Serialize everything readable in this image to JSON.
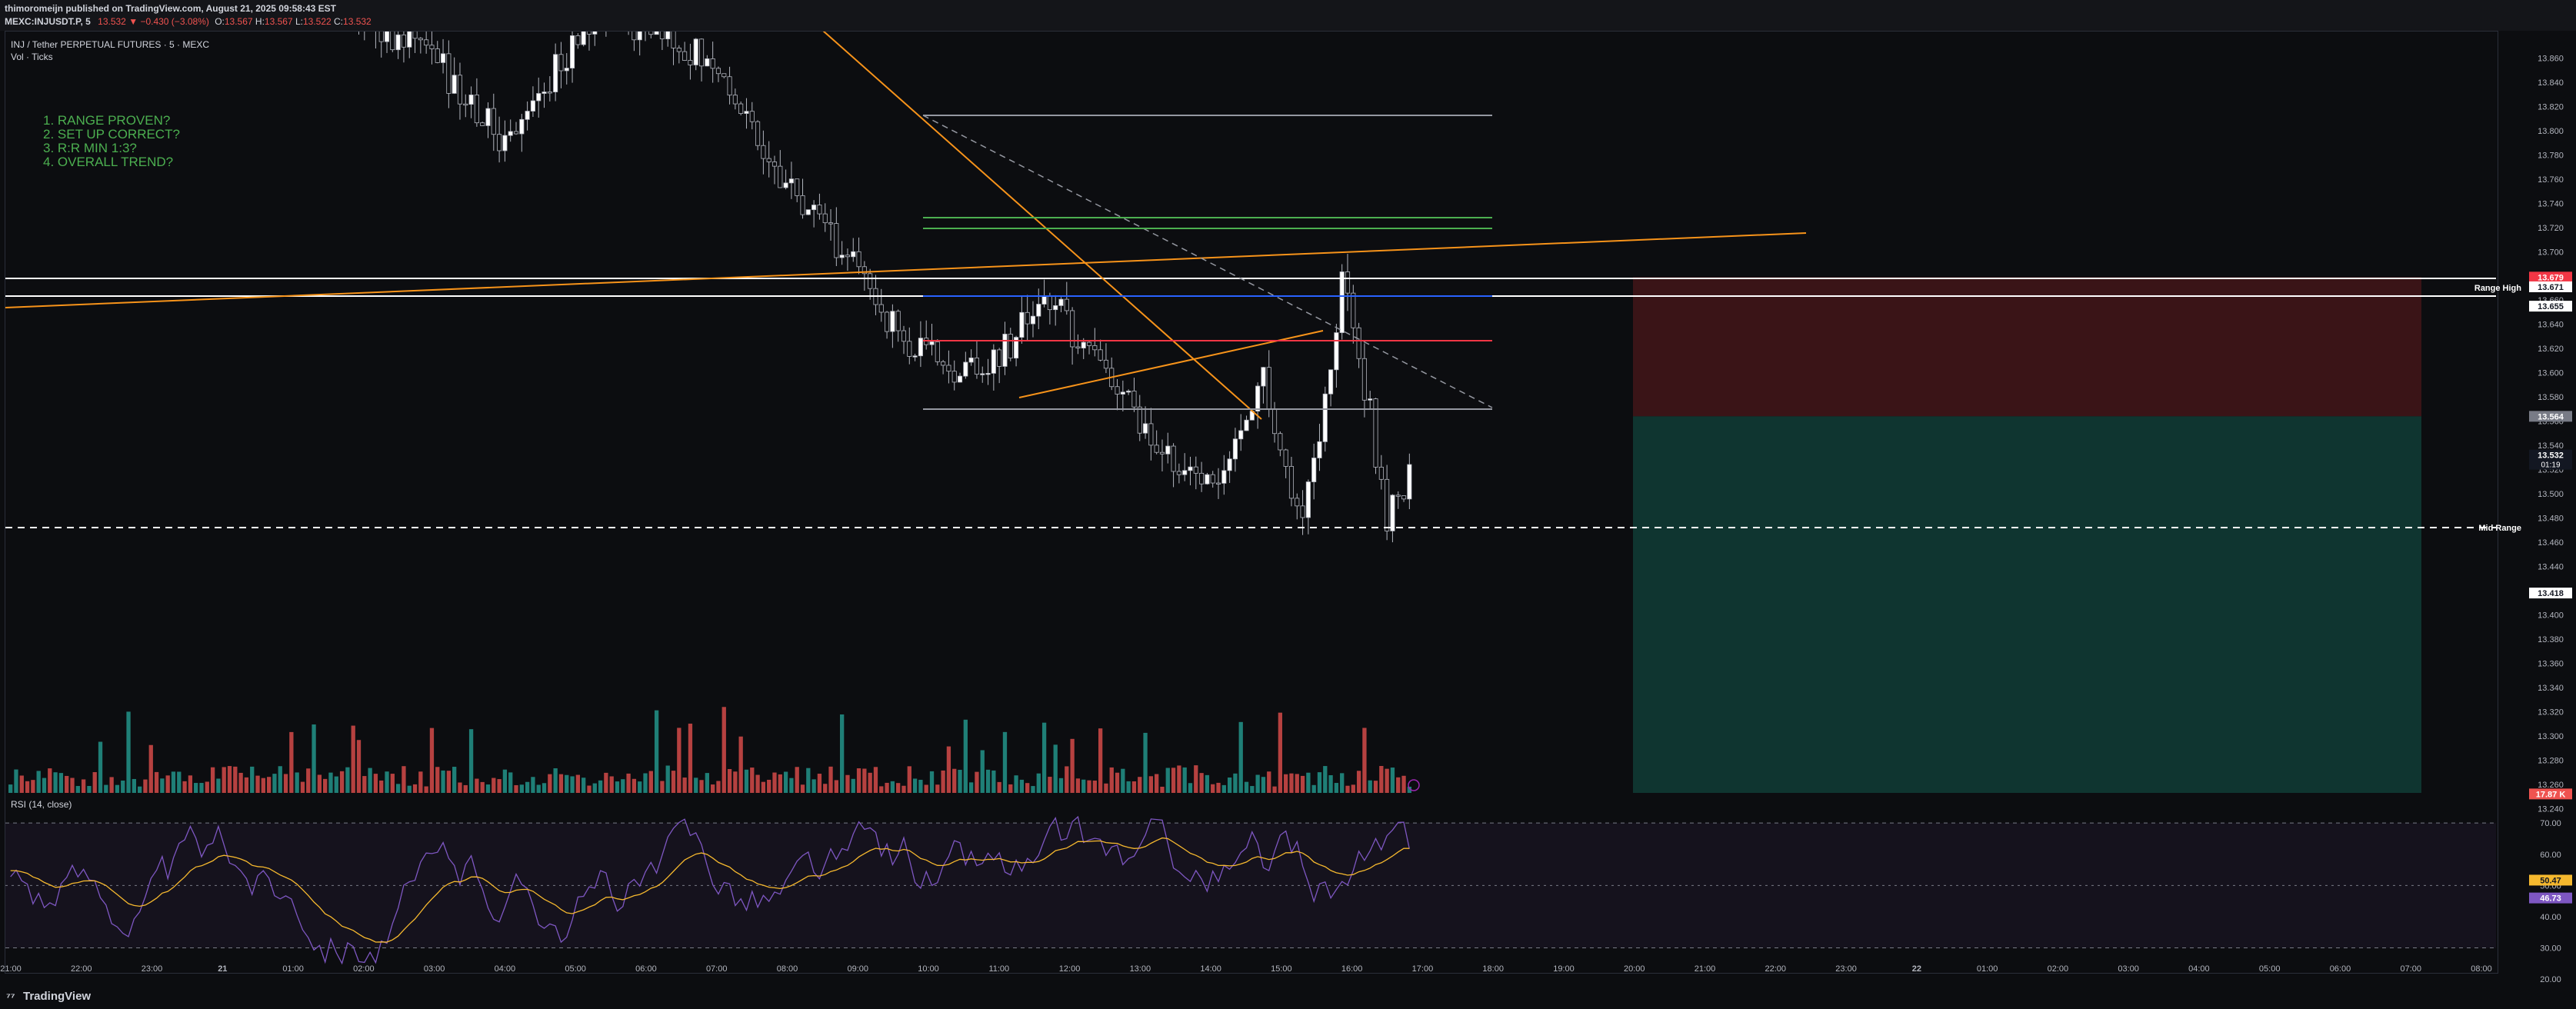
{
  "header": {
    "publisher_line": "thimoromeijn published on TradingView.com, August 21, 2025 09:58:43 EST",
    "symbol": "MEXC:INJUSDT.P, 5",
    "last": "13.532",
    "change_arrow": "▼",
    "change": "−0.430 (−3.08%)",
    "open": "13.567",
    "high": "13.567",
    "low": "13.522",
    "close": "13.532",
    "ohlc_labels": [
      "O:",
      "H:",
      "L:",
      "C:"
    ]
  },
  "legend": {
    "title": "INJ / Tether PERPETUAL FUTURES · 5 · MEXC",
    "subtitle": "Vol · Ticks"
  },
  "checklist": [
    "1. RANGE PROVEN?",
    "2. SET UP CORRECT?",
    "3. R:R MIN 1:3?",
    "4. OVERALL TREND?"
  ],
  "rsi_label": "RSI (14, close)",
  "footer_brand": "TradingView",
  "colors": {
    "bg": "#0c0d10",
    "up": "#26a69a",
    "down": "#ef5350",
    "candle_up": "#ffffff",
    "orange": "#f7931a",
    "green_line": "#4caf50",
    "red_line": "#f23645",
    "blue_line": "#2962ff",
    "rsi_line": "#7e57c2",
    "rsi_ma": "#f5b82e",
    "tp_zone": "#0f3530",
    "sl_zone": "#3a1417"
  },
  "chart_data": {
    "type": "candlestick",
    "title": "INJ / Tether PERPETUAL FUTURES · 5 · MEXC",
    "price_axis": {
      "ylim": [
        13.23,
        13.88
      ],
      "ticks": [
        "13.860",
        "13.840",
        "13.820",
        "13.800",
        "13.780",
        "13.760",
        "13.740",
        "13.720",
        "13.700",
        "13.680",
        "13.660",
        "13.640",
        "13.620",
        "13.600",
        "13.580",
        "13.560",
        "13.540",
        "13.520",
        "13.500",
        "13.480",
        "13.460",
        "13.440",
        "13.420",
        "13.400",
        "13.380",
        "13.360",
        "13.340",
        "13.320",
        "13.300",
        "13.280",
        "13.260",
        "13.240"
      ]
    },
    "time_axis": {
      "labels": [
        "21:00",
        "22:00",
        "23:00",
        "21",
        "01:00",
        "02:00",
        "03:00",
        "04:00",
        "05:00",
        "06:00",
        "07:00",
        "08:00",
        "09:00",
        "10:00",
        "11:00",
        "12:00",
        "13:00",
        "14:00",
        "15:00",
        "16:00",
        "17:00",
        "18:00",
        "19:00",
        "20:00",
        "21:00",
        "22:00",
        "23:00",
        "22",
        "01:00",
        "02:00",
        "03:00",
        "04:00",
        "05:00",
        "06:00",
        "07:00",
        "08:00"
      ]
    },
    "price_labels": [
      {
        "value": "13.679",
        "price": 13.679,
        "color": "#f23645"
      },
      {
        "value": "13.671",
        "price": 13.671,
        "color": "#ffffff"
      },
      {
        "value": "13.655",
        "price": 13.655,
        "color": "#ffffff"
      },
      {
        "value": "13.564",
        "price": 13.564,
        "color": "#787b86"
      },
      {
        "value": "13.532",
        "price": 13.532,
        "color": "#131722",
        "sub": "01:19"
      },
      {
        "value": "13.418",
        "price": 13.418,
        "color": "#ffffff"
      },
      {
        "value": "17.87 K",
        "price": 13.252,
        "color": "#ef5350"
      }
    ],
    "levels": [
      {
        "name": "Range High",
        "price": 13.664
      },
      {
        "name": "Mid Range",
        "price": 13.418
      }
    ],
    "position": {
      "entry": 13.564,
      "stop": 13.679,
      "target": 13.232
    },
    "rsi": {
      "label": "RSI (14, close)",
      "ylim": [
        22,
        73
      ],
      "ticks": [
        "70.00",
        "60.00",
        "50.00",
        "40.00",
        "30.00",
        "20.00"
      ],
      "bands": [
        70,
        30
      ],
      "value_ma": "50.47",
      "value_rsi": "46.73"
    }
  }
}
